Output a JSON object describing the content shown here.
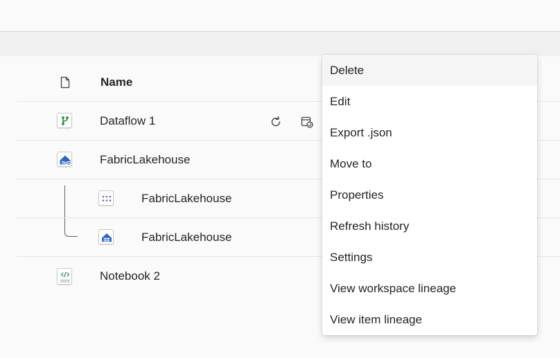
{
  "header": {
    "name_column": "Name"
  },
  "rows": [
    {
      "label": "Dataflow 1",
      "icon": "dataflow-icon"
    },
    {
      "label": "FabricLakehouse",
      "icon": "lakehouse-icon"
    },
    {
      "label": "FabricLakehouse",
      "icon": "semantic-model-icon"
    },
    {
      "label": "FabricLakehouse",
      "icon": "sql-endpoint-icon"
    },
    {
      "label": "Notebook 2",
      "icon": "notebook-icon"
    }
  ],
  "row_actions": {
    "refresh": "refresh-icon",
    "schedule": "schedule-refresh-icon"
  },
  "context_menu": {
    "items": [
      "Delete",
      "Edit",
      "Export .json",
      "Move to",
      "Properties",
      "Refresh history",
      "Settings",
      "View workspace lineage",
      "View item lineage"
    ],
    "highlighted_item": "Delete"
  },
  "colors": {
    "dataflow_green": "#2d8a3e",
    "lakehouse_blue": "#2b67c6",
    "semantic_model_purple": "#6b5fad",
    "notebook_green": "#2f7d4f"
  }
}
